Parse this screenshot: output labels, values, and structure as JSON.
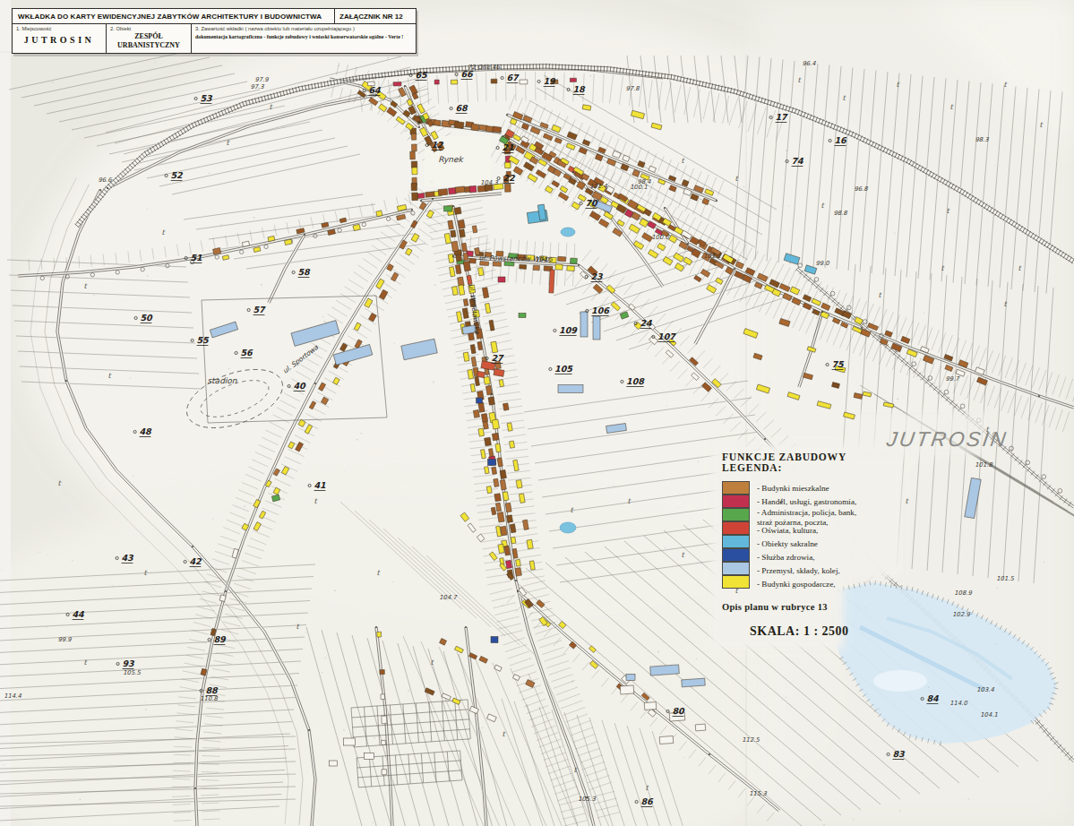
{
  "header": {
    "title": "WKŁADKA DO KARTY EWIDENCYJNEJ ZABYTKÓW ARCHITEKTURY I BUDOWNICTWA",
    "attachment": "ZAŁĄCZNIK NR 12",
    "field1_label": "1. Miejscowość",
    "field1_value": "JUTROSIN",
    "field2_label": "2. Obiekt",
    "field2_value": "ZESPÓŁ URBANISTYCZNY",
    "field3_label": "3. Zawartość wkładki ( nazwa obiektu lub materiału uzupełniającego )",
    "field3_value": "dokumentacja kartograficzna - funkcje zabudowy i wnioski konserwatorskie ogólne - Verte !"
  },
  "legend": {
    "title_line1": "FUNKCJE ZABUDOWY",
    "title_line2": "LEGENDA:",
    "items": [
      {
        "lines": [
          "- Budynki mieszkalne"
        ],
        "color": "#bf7f3c"
      },
      {
        "lines": [
          "- Handel, usługi, gastronomia,"
        ],
        "color": "#c23050"
      },
      {
        "lines": [
          "- Administracja, policja, bank,",
          "straż pożarna, poczta,"
        ],
        "color": "#58a74c"
      },
      {
        "lines": [
          "- Oświata, kultura,"
        ],
        "color": "#cf4436"
      },
      {
        "lines": [
          "- Obiekty sakralne"
        ],
        "color": "#62b8da"
      },
      {
        "lines": [
          "- Służba zdrowia,"
        ],
        "color": "#2b4fa0"
      },
      {
        "lines": [
          "- Przemysł, składy, kolej,"
        ],
        "color": "#aac7e4"
      },
      {
        "lines": [
          "- Budynki gospodarcze,"
        ],
        "color": "#f1e335"
      }
    ],
    "note": "Opis planu w rubryce 13",
    "scale": "SKALA: 1 : 2500"
  },
  "map": {
    "town_label": "JUTROSIN",
    "meadow_mark": "t",
    "colors": {
      "residential": "#a9672f",
      "commerce": "#c23050",
      "administration": "#58a74c",
      "education": "#d0563a",
      "sacral": "#62b8da",
      "health": "#2b4fa0",
      "industry": "#aac7e4",
      "outbuilding": "#f1e335",
      "neutral": "#f6f5f0"
    },
    "labels": {
      "sheets": [
        [
          "53",
          230,
          113
        ],
        [
          "52",
          197,
          199
        ],
        [
          "51",
          219,
          291
        ],
        [
          "58",
          339,
          307
        ],
        [
          "50",
          163,
          358
        ],
        [
          "57",
          289,
          349
        ],
        [
          "55",
          226,
          383
        ],
        [
          "56",
          275,
          397
        ],
        [
          "40",
          334,
          434
        ],
        [
          "48",
          162,
          485
        ],
        [
          "41",
          357,
          545
        ],
        [
          "42",
          218,
          630
        ],
        [
          "43",
          142,
          626
        ],
        [
          "44",
          87,
          689
        ],
        [
          "93",
          143,
          744
        ],
        [
          "89",
          245,
          717
        ],
        [
          "88",
          236,
          774
        ],
        [
          "64",
          418,
          104
        ],
        [
          "65",
          470,
          87
        ],
        [
          "66",
          521,
          86
        ],
        [
          "67",
          572,
          90
        ],
        [
          "68",
          515,
          124
        ],
        [
          "19",
          613,
          94
        ],
        [
          "18",
          646,
          103
        ],
        [
          "12",
          488,
          165
        ],
        [
          "21",
          567,
          168
        ],
        [
          "22",
          568,
          202
        ],
        [
          "70",
          660,
          230
        ],
        [
          "16",
          938,
          160
        ],
        [
          "17",
          872,
          134
        ],
        [
          "74",
          890,
          183
        ],
        [
          "75",
          935,
          410
        ],
        [
          "23",
          666,
          312
        ],
        [
          "24",
          721,
          364
        ],
        [
          "27",
          555,
          403
        ],
        [
          "107",
          744,
          379
        ],
        [
          "108",
          709,
          429
        ],
        [
          "105",
          629,
          415
        ],
        [
          "106",
          670,
          350
        ],
        [
          "109",
          634,
          372
        ],
        [
          "80",
          757,
          797
        ],
        [
          "83",
          1003,
          845
        ],
        [
          "84",
          1041,
          783
        ],
        [
          "86",
          722,
          898
        ]
      ],
      "elevations": [
        [
          "97.9",
          292,
          91
        ],
        [
          "97.3",
          287,
          99
        ],
        [
          "72 Orle 46",
          540,
          77
        ],
        [
          "96.4",
          903,
          73
        ],
        [
          "97.8",
          706,
          101
        ],
        [
          "98.3",
          1096,
          158
        ],
        [
          "96.8",
          961,
          213
        ],
        [
          "100.1",
          713,
          211
        ],
        [
          "101.4",
          668,
          210
        ],
        [
          "98.4",
          719,
          205
        ],
        [
          "104.3",
          546,
          206
        ],
        [
          "104.5",
          607,
          292
        ],
        [
          "100.0",
          737,
          267
        ],
        [
          "99.0",
          918,
          296
        ],
        [
          "101.2",
          795,
          288
        ],
        [
          "99.7",
          1063,
          425
        ],
        [
          "101.8",
          1098,
          521
        ],
        [
          "102.9",
          1073,
          688
        ],
        [
          "108.9",
          1075,
          664
        ],
        [
          "103.4",
          1100,
          772
        ],
        [
          "114.0",
          1070,
          787
        ],
        [
          "104.1",
          1104,
          800
        ],
        [
          "110.8",
          233,
          782
        ],
        [
          "105.5",
          147,
          753
        ],
        [
          "99.9",
          72,
          716
        ],
        [
          "114.4",
          14,
          779
        ],
        [
          "104.7",
          500,
          669
        ],
        [
          "112.5",
          838,
          828
        ],
        [
          "115.3",
          846,
          888
        ],
        [
          "105.3",
          655,
          894
        ],
        [
          "101.5",
          1122,
          648
        ],
        [
          "98.8",
          938,
          240
        ],
        [
          "96.6",
          117,
          203
        ]
      ],
      "names": [
        [
          "Rynek",
          503,
          181
        ],
        [
          "stadion",
          248,
          428
        ]
      ],
      "streets": [
        [
          "ul. Powstańców Wlkp.",
          575,
          291,
          1
        ],
        [
          "ul. Sportowa",
          337,
          403,
          -37
        ],
        [
          "ul. Wrocławska",
          527,
          345,
          83
        ]
      ]
    }
  }
}
